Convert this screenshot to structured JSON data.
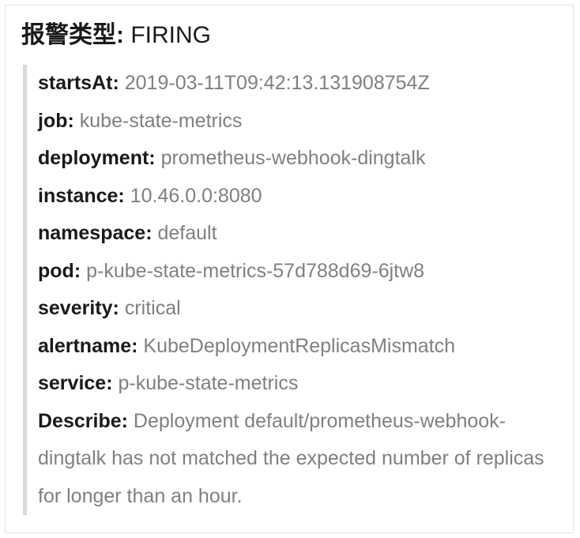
{
  "title": {
    "label": "报警类型:",
    "value": "FIRING"
  },
  "fields": {
    "startsAt": {
      "label": "startsAt:",
      "value": "2019-03-11T09:42:13.131908754Z"
    },
    "job": {
      "label": "job:",
      "value": "kube-state-metrics"
    },
    "deployment": {
      "label": "deployment:",
      "value": "prometheus-webhook-dingtalk"
    },
    "instance": {
      "label": "instance:",
      "value": "10.46.0.0:8080"
    },
    "namespace": {
      "label": "namespace:",
      "value": "default"
    },
    "pod": {
      "label": "pod:",
      "value": "p-kube-state-metrics-57d788d69-6jtw8"
    },
    "severity": {
      "label": "severity:",
      "value": "critical"
    },
    "alertname": {
      "label": "alertname:",
      "value": "KubeDeploymentReplicasMismatch"
    },
    "service": {
      "label": "service:",
      "value": "p-kube-state-metrics"
    },
    "describe": {
      "label": "Describe:",
      "value": "Deployment default/prometheus-webhook-dingtalk has not matched the expected number of replicas for longer than an hour."
    }
  }
}
